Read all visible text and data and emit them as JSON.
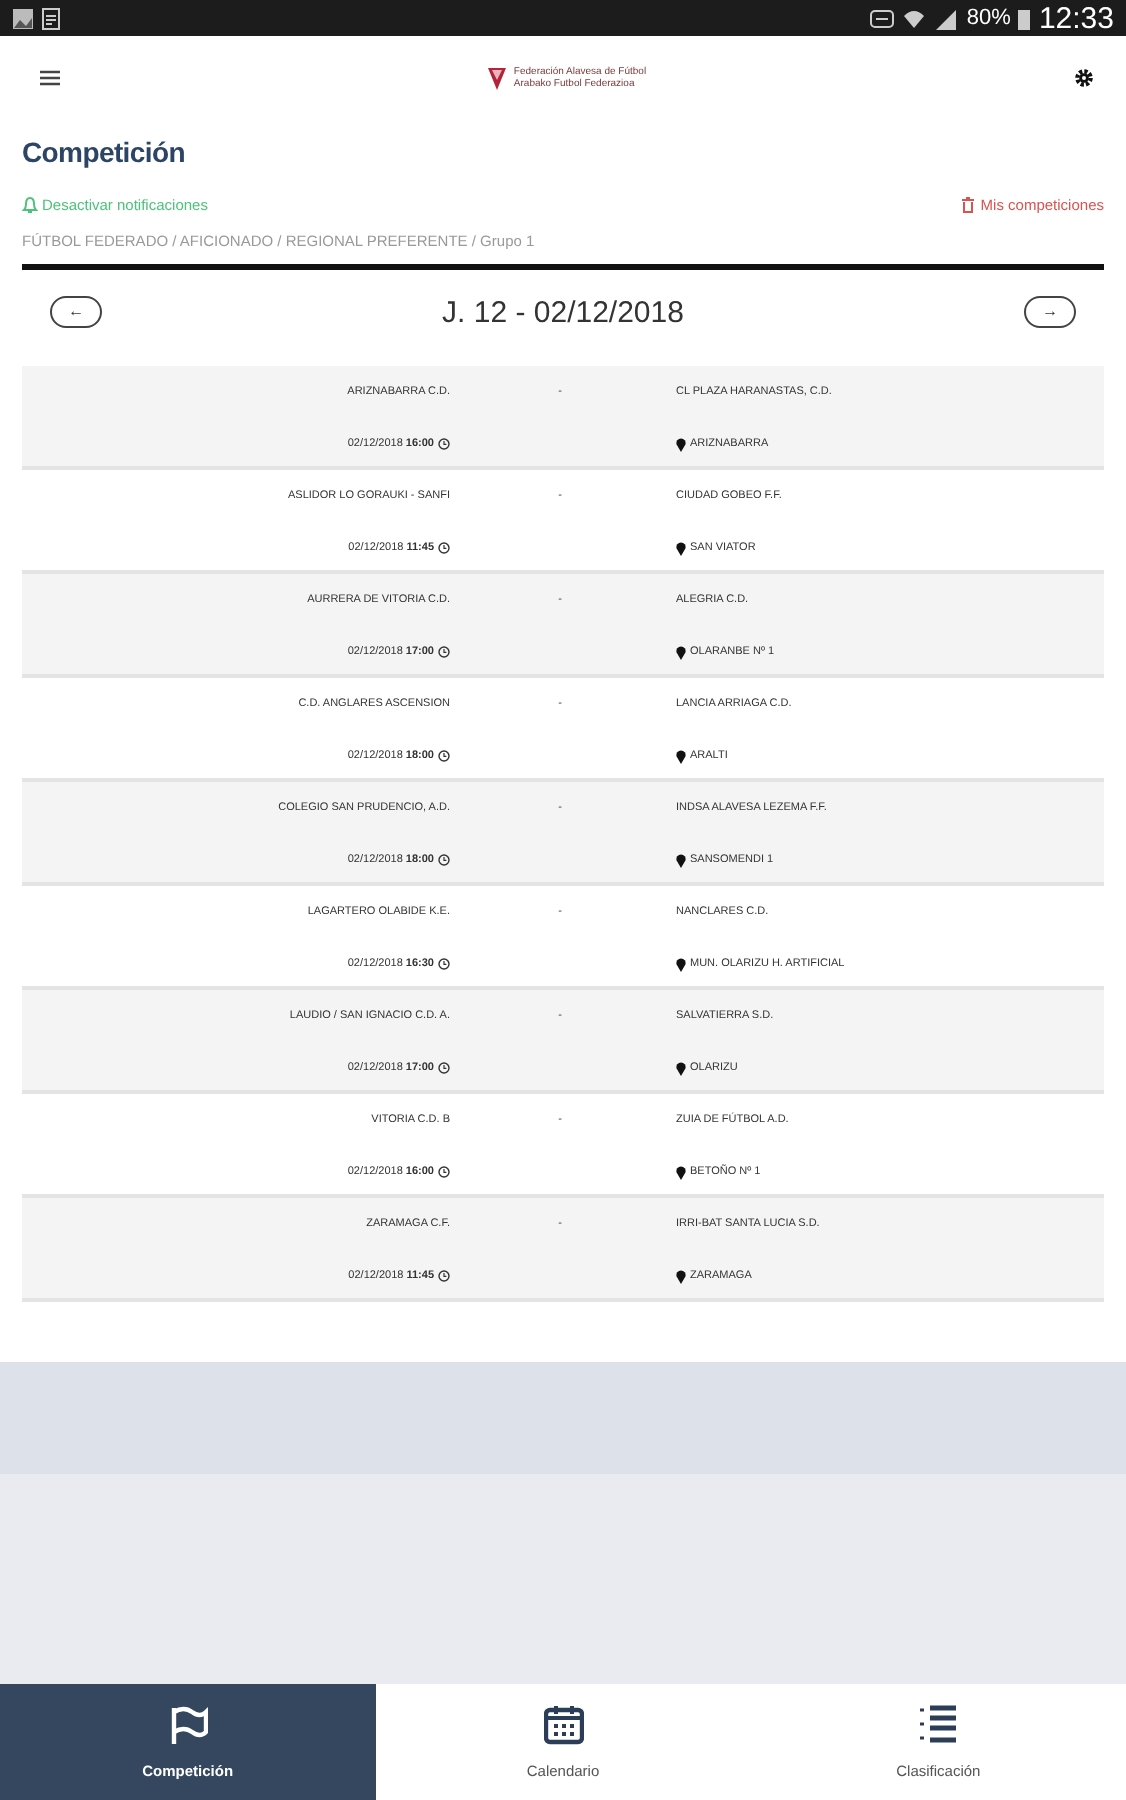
{
  "status_bar": {
    "battery": "80%",
    "time": "12:33"
  },
  "header": {
    "logo_line_1": "Federación Alavesa de Fútbol",
    "logo_line_2": "Arabako Futbol Federazioa"
  },
  "page": {
    "title": "Competición",
    "notifications_link": "Desactivar notificaciones",
    "my_competitions_link": "Mis competiciones",
    "breadcrumb": "FÚTBOL FEDERADO / AFICIONADO / REGIONAL PREFERENTE / Grupo 1"
  },
  "round_nav": {
    "prev": "←",
    "label": "J. 12 - 02/12/2018",
    "next": "→"
  },
  "matches": [
    {
      "home": "ARIZNABARRA C.D.",
      "date": "02/12/2018",
      "time": "16:00",
      "score": "-",
      "away": "CL PLAZA HARANASTAS, C.D.",
      "venue": "ARIZNABARRA"
    },
    {
      "home": "ASLIDOR LO GORAUKI - SANFI",
      "date": "02/12/2018",
      "time": "11:45",
      "score": "-",
      "away": "CIUDAD GOBEO F.F.",
      "venue": "SAN VIATOR"
    },
    {
      "home": "AURRERA DE VITORIA C.D.",
      "date": "02/12/2018",
      "time": "17:00",
      "score": "-",
      "away": "ALEGRIA C.D.",
      "venue": "OLARANBE Nº 1"
    },
    {
      "home": "C.D. ANGLARES ASCENSION",
      "date": "02/12/2018",
      "time": "18:00",
      "score": "-",
      "away": "LANCIA ARRIAGA C.D.",
      "venue": "ARALTI"
    },
    {
      "home": "COLEGIO SAN PRUDENCIO, A.D.",
      "date": "02/12/2018",
      "time": "18:00",
      "score": "-",
      "away": "INDSA ALAVESA LEZEMA F.F.",
      "venue": "SANSOMENDI 1"
    },
    {
      "home": "LAGARTERO OLABIDE K.E.",
      "date": "02/12/2018",
      "time": "16:30",
      "score": "-",
      "away": "NANCLARES C.D.",
      "venue": "MUN. OLARIZU H. ARTIFICIAL"
    },
    {
      "home": "LAUDIO / SAN IGNACIO C.D. A.",
      "date": "02/12/2018",
      "time": "17:00",
      "score": "-",
      "away": "SALVATIERRA S.D.",
      "venue": "OLARIZU"
    },
    {
      "home": "VITORIA C.D. B",
      "date": "02/12/2018",
      "time": "16:00",
      "score": "-",
      "away": "ZUIA DE FÚTBOL A.D.",
      "venue": "BETOÑO Nº 1"
    },
    {
      "home": "ZARAMAGA C.F.",
      "date": "02/12/2018",
      "time": "11:45",
      "score": "-",
      "away": "IRRI-BAT SANTA LUCIA S.D.",
      "venue": "ZARAMAGA"
    }
  ],
  "bottom_nav": [
    {
      "label": "Competición",
      "kind": "flag",
      "selected": true
    },
    {
      "label": "Calendario",
      "kind": "calendar",
      "selected": false
    },
    {
      "label": "Clasificación",
      "kind": "list",
      "selected": false
    }
  ]
}
